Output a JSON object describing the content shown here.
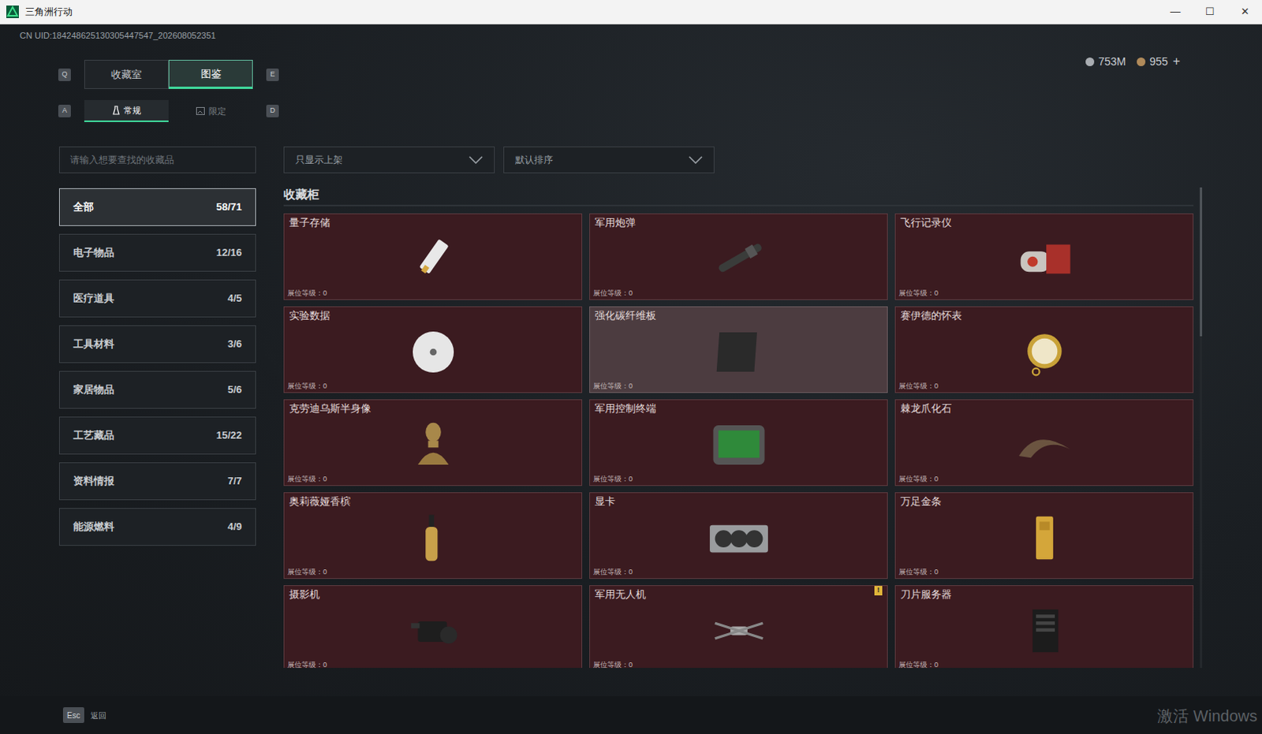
{
  "window": {
    "title": "三角洲行动",
    "controls": [
      "—",
      "☐",
      "✕"
    ]
  },
  "uid": "CN UID:184248625130305447547_202608052351",
  "currency": [
    {
      "value": "753M",
      "color": "#a9adb2"
    },
    {
      "value": "955",
      "color": "#b08a5a"
    }
  ],
  "currency_add": "+",
  "tabs": {
    "prev_key": "Q",
    "next_key": "E",
    "items": [
      {
        "label": "收藏室",
        "selected": false
      },
      {
        "label": "图鉴",
        "selected": true
      }
    ]
  },
  "subtabs": {
    "prev_key": "A",
    "next_key": "D",
    "items": [
      {
        "label": "常规",
        "selected": true
      },
      {
        "label": "限定",
        "selected": false
      }
    ]
  },
  "search": {
    "placeholder": "请输入想要查找的收藏品"
  },
  "filters": [
    {
      "label": "只显示上架"
    },
    {
      "label": "默认排序"
    }
  ],
  "categories": [
    {
      "label": "全部",
      "count": "58/71",
      "selected": true
    },
    {
      "label": "电子物品",
      "count": "12/16",
      "selected": false
    },
    {
      "label": "医疗道具",
      "count": "4/5",
      "selected": false
    },
    {
      "label": "工具材料",
      "count": "3/6",
      "selected": false
    },
    {
      "label": "家居物品",
      "count": "5/6",
      "selected": false
    },
    {
      "label": "工艺藏品",
      "count": "15/22",
      "selected": false
    },
    {
      "label": "资料情报",
      "count": "7/7",
      "selected": false
    },
    {
      "label": "能源燃料",
      "count": "4/9",
      "selected": false
    }
  ],
  "section_title": "收藏柜",
  "level_label": "展位等级：",
  "alert_badge": "!",
  "items": [
    {
      "name": "量子存储",
      "level": "0",
      "highlighted": false,
      "alert": false
    },
    {
      "name": "军用炮弹",
      "level": "0",
      "highlighted": false,
      "alert": false
    },
    {
      "name": "飞行记录仪",
      "level": "0",
      "highlighted": false,
      "alert": false
    },
    {
      "name": "实验数据",
      "level": "0",
      "highlighted": false,
      "alert": false
    },
    {
      "name": "强化碳纤维板",
      "level": "0",
      "highlighted": true,
      "alert": false
    },
    {
      "name": "赛伊德的怀表",
      "level": "0",
      "highlighted": false,
      "alert": false
    },
    {
      "name": "克劳迪乌斯半身像",
      "level": "0",
      "highlighted": false,
      "alert": false
    },
    {
      "name": "军用控制终端",
      "level": "0",
      "highlighted": false,
      "alert": false
    },
    {
      "name": "棘龙爪化石",
      "level": "0",
      "highlighted": false,
      "alert": false
    },
    {
      "name": "奥莉薇娅香槟",
      "level": "0",
      "highlighted": false,
      "alert": false
    },
    {
      "name": "显卡",
      "level": "0",
      "highlighted": false,
      "alert": false
    },
    {
      "name": "万足金条",
      "level": "0",
      "highlighted": false,
      "alert": false
    },
    {
      "name": "摄影机",
      "level": "0",
      "highlighted": false,
      "alert": false
    },
    {
      "name": "军用无人机",
      "level": "0",
      "highlighted": false,
      "alert": true
    },
    {
      "name": "刀片服务器",
      "level": "0",
      "highlighted": false,
      "alert": false
    }
  ],
  "scrollbar": {
    "level": 0.31
  },
  "footer": {
    "key": "Esc",
    "label": "返回"
  },
  "watermark": "激活 Windows"
}
